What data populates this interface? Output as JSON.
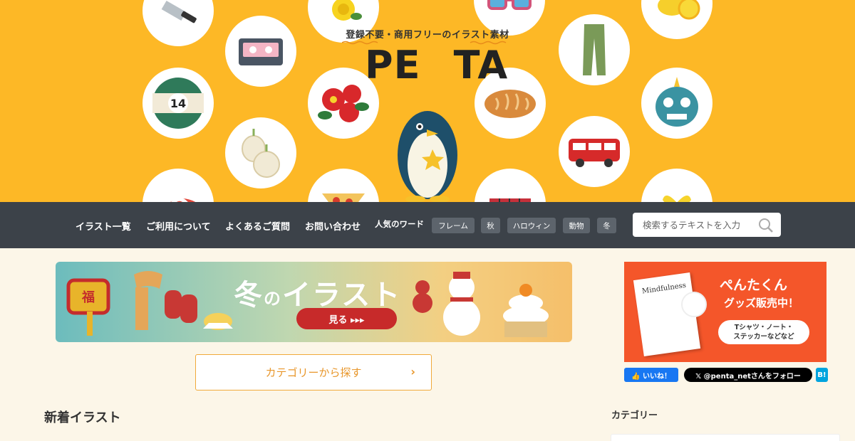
{
  "hero": {
    "tagline": "登録不要・商用フリーのイラスト素材",
    "logo_pre": "PE",
    "logo_n": "N",
    "logo_post": "TA",
    "brand_color": "#fdb826",
    "bubbles": [
      "knife-icon",
      "rose-icon",
      "sunglasses-icon",
      "lemon-icon",
      "cassette-icon",
      "pants-icon",
      "billiard-ball-icon",
      "camellia-icon",
      "bread-icon",
      "oni-mask-icon",
      "onion-icon",
      "bus-icon",
      "umbrella-icon",
      "pizza-icon",
      "accordion-icon",
      "gift-icon"
    ],
    "billiard_number": "14"
  },
  "nav": {
    "links": [
      "イラスト一覧",
      "ご利用について",
      "よくあるご質問",
      "お問い合わせ"
    ],
    "popular_label": "人気のワード",
    "tags": [
      "フレーム",
      "秋",
      "ハロウィン",
      "動物",
      "冬"
    ],
    "search_placeholder": "検索するテキストを入力"
  },
  "banner": {
    "title_big": "冬",
    "title_small": "の",
    "title_rest": "イラスト",
    "button_label": "見る ▸▸▸",
    "lucky_char": "福"
  },
  "category_button": {
    "label": "カテゴリーから探す",
    "chevron": "›"
  },
  "new_section": {
    "title": "新着イラスト"
  },
  "promo": {
    "line1": "ぺんたくん",
    "line2": "グッズ販売中！",
    "pill": "Tシャツ・ノート・\nステッカーなどなど",
    "card_text": "Mindfulness"
  },
  "social": {
    "facebook": "👍 いいね！",
    "twitter": "𝕏 @penta_netさんをフォロー",
    "hatena": "B!"
  },
  "sidebar": {
    "category_heading": "カテゴリー"
  }
}
